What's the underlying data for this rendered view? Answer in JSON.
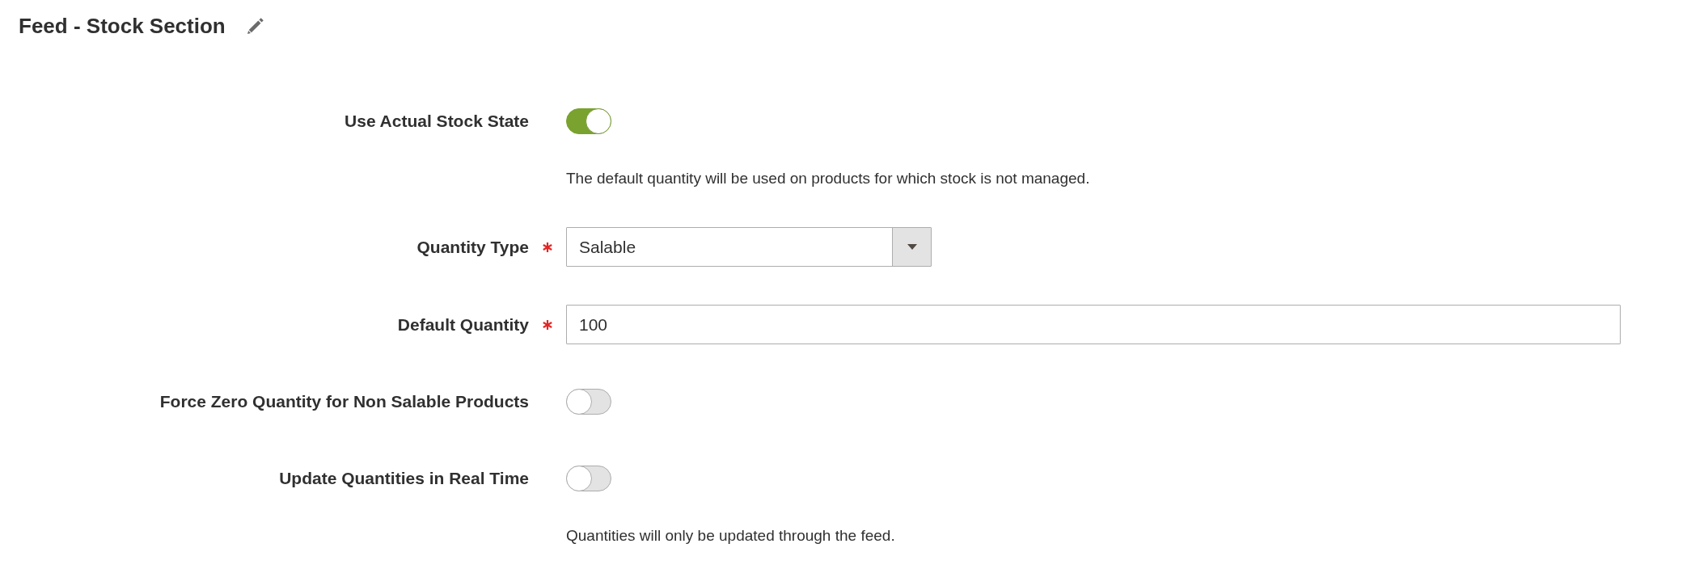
{
  "page": {
    "title": "Feed - Stock Section"
  },
  "fields": [
    {
      "kind": "toggle",
      "label": "Use Actual Stock State",
      "required": false,
      "on": true,
      "note": "The default quantity will be used on products for which stock is not managed."
    },
    {
      "kind": "select",
      "label": "Quantity Type",
      "required": true,
      "value": "Salable"
    },
    {
      "kind": "text",
      "label": "Default Quantity",
      "required": true,
      "value": "100"
    },
    {
      "kind": "toggle",
      "label": "Force Zero Quantity for Non Salable Products",
      "required": false,
      "on": false
    },
    {
      "kind": "toggle",
      "label": "Update Quantities in Real Time",
      "required": false,
      "on": false,
      "note": "Quantities will only be updated through the feed."
    }
  ]
}
